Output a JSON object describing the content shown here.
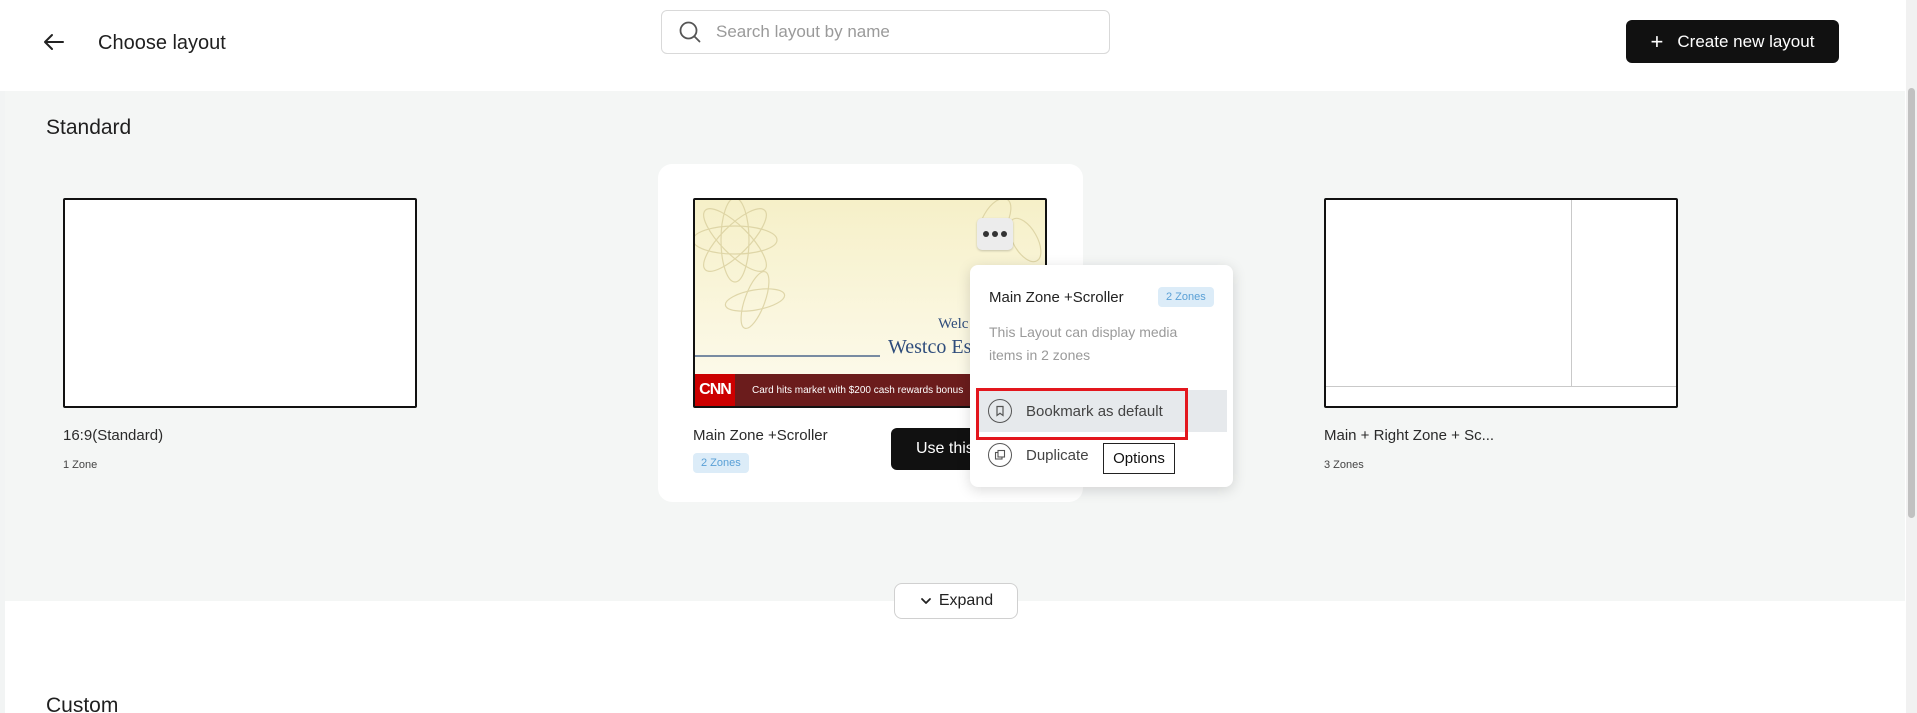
{
  "header": {
    "title": "Choose layout",
    "search_placeholder": "Search layout by name",
    "create_button": "Create new layout",
    "create_icon": "plus-icon"
  },
  "standard": {
    "section_title": "Standard",
    "layouts": [
      {
        "name": "16:9(Standard)",
        "zones": "1 Zone"
      },
      {
        "name": "Main Zone +Scroller",
        "zones": "2 Zones",
        "thumb_title_line1": "Welc",
        "thumb_title_line2": "Westco Es",
        "ticker_logo": "CNN",
        "ticker_text": "Card hits market with $200 cash rewards bonus",
        "use_button": "Use this"
      },
      {
        "name": "Main + Right Zone + Sc...",
        "zones": "3 Zones"
      }
    ]
  },
  "popup": {
    "title": "Main Zone +Scroller",
    "badge": "2 Zones",
    "description": "This Layout can display media items in 2 zones",
    "items": [
      {
        "label": "Bookmark as default",
        "icon": "bookmark-icon"
      },
      {
        "label": "Duplicate",
        "icon": "duplicate-icon"
      }
    ],
    "tooltip": "Options"
  },
  "expand_button": "Expand",
  "custom": {
    "section_title": "Custom"
  },
  "colors": {
    "primary": "#111111",
    "highlight": "#e3161d",
    "badge_bg": "#dcecf8",
    "badge_text": "#5aa0d6"
  }
}
